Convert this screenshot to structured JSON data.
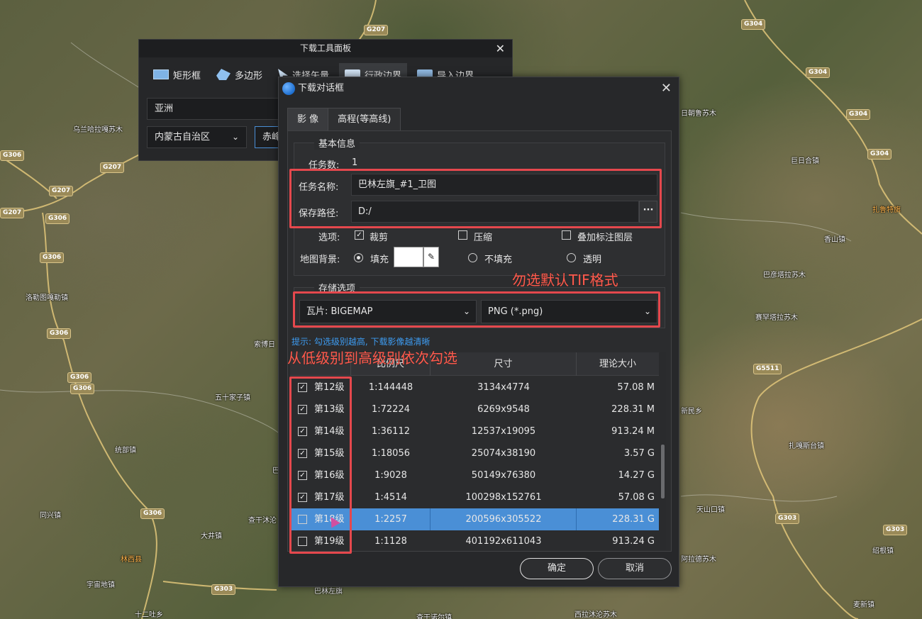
{
  "map": {
    "places": [
      "乌兰哈拉嘎苏木",
      "洛勒图嘎勒镇",
      "五十家子镇",
      "索博日",
      "统部镇",
      "巴",
      "同兴镇",
      "查干沐沦",
      "大井镇",
      "林西县",
      "宇宙地镇",
      "十二吐乡",
      "巴彦塔拉苏木",
      "赛罕塔拉苏木",
      "巨日合镇",
      "香山镇",
      "扎鲁特旗",
      "日朝鲁苏木",
      "新民乡",
      "扎嘎斯台镇",
      "天山口镇",
      "绍根镇",
      "阿拉德苏木",
      "麦新镇",
      "西拉沐沦苏木",
      "查干诺尔镇",
      "巴林左旗"
    ],
    "roads": [
      "G207",
      "G207",
      "G207",
      "G207",
      "G306",
      "G306",
      "G306",
      "G306",
      "G306",
      "G306",
      "G306",
      "G304",
      "G304",
      "G304",
      "G304",
      "G5511",
      "G303",
      "G303",
      "G303"
    ]
  },
  "toolbox": {
    "title": "下载工具面板",
    "tools": [
      "矩形框",
      "多边形",
      "选择矢量",
      "行政边界",
      "导入边界"
    ],
    "region_field": "亚洲",
    "province_select": "内蒙古自治区",
    "city_select": "赤峰"
  },
  "dialog": {
    "title": "下载对话框",
    "tabs": [
      "影 像",
      "高程(等高线)"
    ],
    "basic_info": {
      "section_title": "基本信息",
      "task_count_label": "任务数:",
      "task_count_value": "1",
      "task_name_label": "任务名称:",
      "task_name_value": "巴林左旗_#1_卫图",
      "save_path_label": "保存路径:",
      "save_path_value": "D:/",
      "browse_label": "···",
      "options_label": "选项:",
      "options": [
        {
          "label": "裁剪",
          "checked": true
        },
        {
          "label": "压缩",
          "checked": false
        },
        {
          "label": "叠加标注图层",
          "checked": false
        }
      ],
      "background_label": "地图背景:",
      "background_options": [
        {
          "label": "填充",
          "selected": true
        },
        {
          "label": "不填充",
          "selected": false
        },
        {
          "label": "透明",
          "selected": false
        }
      ],
      "fill_color": "#ffffff"
    },
    "storage": {
      "section_title": "存储选项",
      "tile_select": "瓦片: BIGEMAP",
      "format_select": "PNG (*.png)"
    },
    "hint": "提示: 勾选级别越高, 下载影像越清晰",
    "table": {
      "headers": [
        "比例尺",
        "尺寸",
        "理论大小"
      ],
      "rows": [
        {
          "level": "第12级",
          "checked": true,
          "scale": "1:144448",
          "size": "3134x4774",
          "filesize": "57.08 M"
        },
        {
          "level": "第13级",
          "checked": true,
          "scale": "1:72224",
          "size": "6269x9548",
          "filesize": "228.31 M"
        },
        {
          "level": "第14级",
          "checked": true,
          "scale": "1:36112",
          "size": "12537x19095",
          "filesize": "913.24 M"
        },
        {
          "level": "第15级",
          "checked": true,
          "scale": "1:18056",
          "size": "25074x38190",
          "filesize": "3.57 G"
        },
        {
          "level": "第16级",
          "checked": true,
          "scale": "1:9028",
          "size": "50149x76380",
          "filesize": "14.27 G"
        },
        {
          "level": "第17级",
          "checked": true,
          "scale": "1:4514",
          "size": "100298x152761",
          "filesize": "57.08 G"
        },
        {
          "level": "第18级",
          "checked": false,
          "scale": "1:2257",
          "size": "200596x305522",
          "filesize": "228.31 G",
          "selected": true
        },
        {
          "level": "第19级",
          "checked": false,
          "scale": "1:1128",
          "size": "401192x611043",
          "filesize": "913.24 G"
        }
      ]
    },
    "ok_label": "确定",
    "cancel_label": "取消"
  },
  "annotations": {
    "tif_note": "勿选默认TIF格式",
    "level_note": "从低级别到高级别依次勾选",
    "highlight_color": "#e5484d"
  }
}
